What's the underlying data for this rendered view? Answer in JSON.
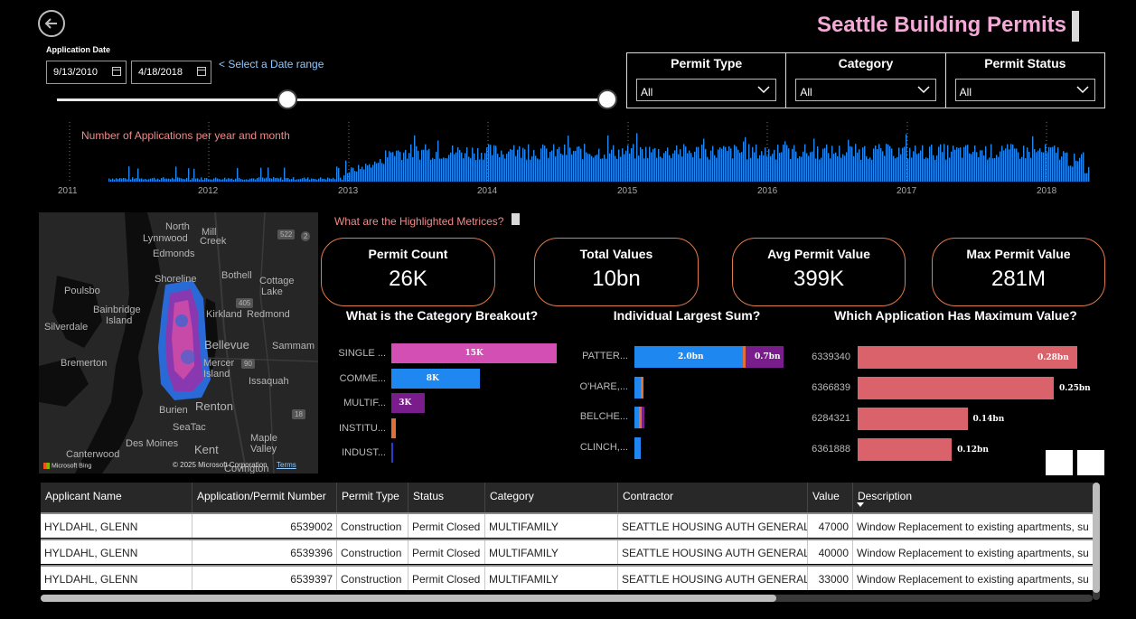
{
  "header": {
    "title": "Seattle Building Permits"
  },
  "date_filter": {
    "label": "Application Date",
    "start": "9/13/2010",
    "end": "4/18/2018",
    "hint": "< Select a Date range"
  },
  "filters": [
    {
      "title": "Permit Type",
      "value": "All"
    },
    {
      "title": "Category",
      "value": "All"
    },
    {
      "title": "Permit Status",
      "value": "All"
    }
  ],
  "timeline": {
    "title": "Number of Applications per year and month",
    "years": [
      "2011",
      "2012",
      "2013",
      "2014",
      "2015",
      "2016",
      "2017",
      "2018"
    ],
    "color": "#1e88f0"
  },
  "map": {
    "places": [
      "North",
      "Lynnwood",
      "Mill",
      "Creek",
      "Edmonds",
      "Shoreline",
      "Bothell",
      "Cottage",
      "Lake",
      "Poulsbo",
      "Bainbridge",
      "Island",
      "Kirkland",
      "Redmond",
      "Silverdale",
      "Bellevue",
      "Sammam",
      "Bremerton",
      "Mercer",
      "Island",
      "Issaquah",
      "Burien",
      "Renton",
      "SeaTac",
      "Maple",
      "Valley",
      "Des Moines",
      "Kent",
      "Covington",
      "Canterwood"
    ],
    "road_labels": [
      "522",
      "2",
      "405",
      "90",
      "18"
    ],
    "logo": "Microsoft Bing",
    "copyright": "© 2025 Microsoft Corporation",
    "terms": "Terms"
  },
  "metrics": {
    "question": "What are the Highlighted Metrices?",
    "kpis": [
      {
        "label": "Permit Count",
        "value": "26K"
      },
      {
        "label": "Total Values",
        "value": "10bn"
      },
      {
        "label": "Avg Permit Value",
        "value": "399K"
      },
      {
        "label": "Max Permit Value",
        "value": "281M"
      }
    ]
  },
  "chart_data": [
    {
      "type": "bar",
      "title": "What is the Category Breakout?",
      "categories": [
        "SINGLE ...",
        "COMME...",
        "MULTIF...",
        "INSTITU...",
        "INDUST..."
      ],
      "values": [
        15000,
        8000,
        3000,
        400,
        80
      ],
      "data_labels": [
        "15K",
        "8K",
        "3K",
        "",
        ""
      ],
      "colors": [
        "#d44fb3",
        "#1e88f0",
        "#7a1d8c",
        "#e0703a",
        "#2a3bd0"
      ]
    },
    {
      "type": "bar",
      "title": "Individual Largest Sum?",
      "categories": [
        "PATTER...",
        "O'HARE,...",
        "BELCHE...",
        "CLINCH,..."
      ],
      "series": [
        {
          "values": [
            2.0,
            0.12,
            0.08,
            0.11
          ],
          "color": "#1e88f0"
        },
        {
          "values": [
            0.03,
            0.02,
            0.02,
            0.0
          ],
          "color": "#e0703a"
        },
        {
          "values": [
            0.7,
            0.0,
            0.06,
            0.0
          ],
          "color": "#7a1d8c"
        }
      ],
      "data_labels": [
        "2.0bn",
        "0.7bn"
      ]
    },
    {
      "type": "bar",
      "title": "Which Application Has Maximum Value?",
      "categories": [
        "6339340",
        "6366839",
        "6284321",
        "6361888"
      ],
      "values": [
        0.28,
        0.25,
        0.14,
        0.12
      ],
      "data_labels": [
        "0.28bn",
        "0.25bn",
        "0.14bn",
        "0.12bn"
      ],
      "color": "#d9626b"
    }
  ],
  "table": {
    "columns": [
      "Applicant Name",
      "Application/Permit Number",
      "Permit Type",
      "Status",
      "Category",
      "Contractor",
      "Value",
      "Description"
    ],
    "rows": [
      [
        "HYLDAHL, GLENN",
        "6539002",
        "Construction",
        "Permit Closed",
        "MULTIFAMILY",
        "SEATTLE HOUSING AUTH GENERAL",
        "47000",
        "Window Replacement to existing apartments, su"
      ],
      [
        "HYLDAHL, GLENN",
        "6539396",
        "Construction",
        "Permit Closed",
        "MULTIFAMILY",
        "SEATTLE HOUSING AUTH GENERAL",
        "40000",
        "Window Replacement to existing apartments, su"
      ],
      [
        "HYLDAHL, GLENN",
        "6539397",
        "Construction",
        "Permit Closed",
        "MULTIFAMILY",
        "SEATTLE HOUSING AUTH GENERAL",
        "33000",
        "Window Replacement to existing apartments, su"
      ]
    ]
  }
}
